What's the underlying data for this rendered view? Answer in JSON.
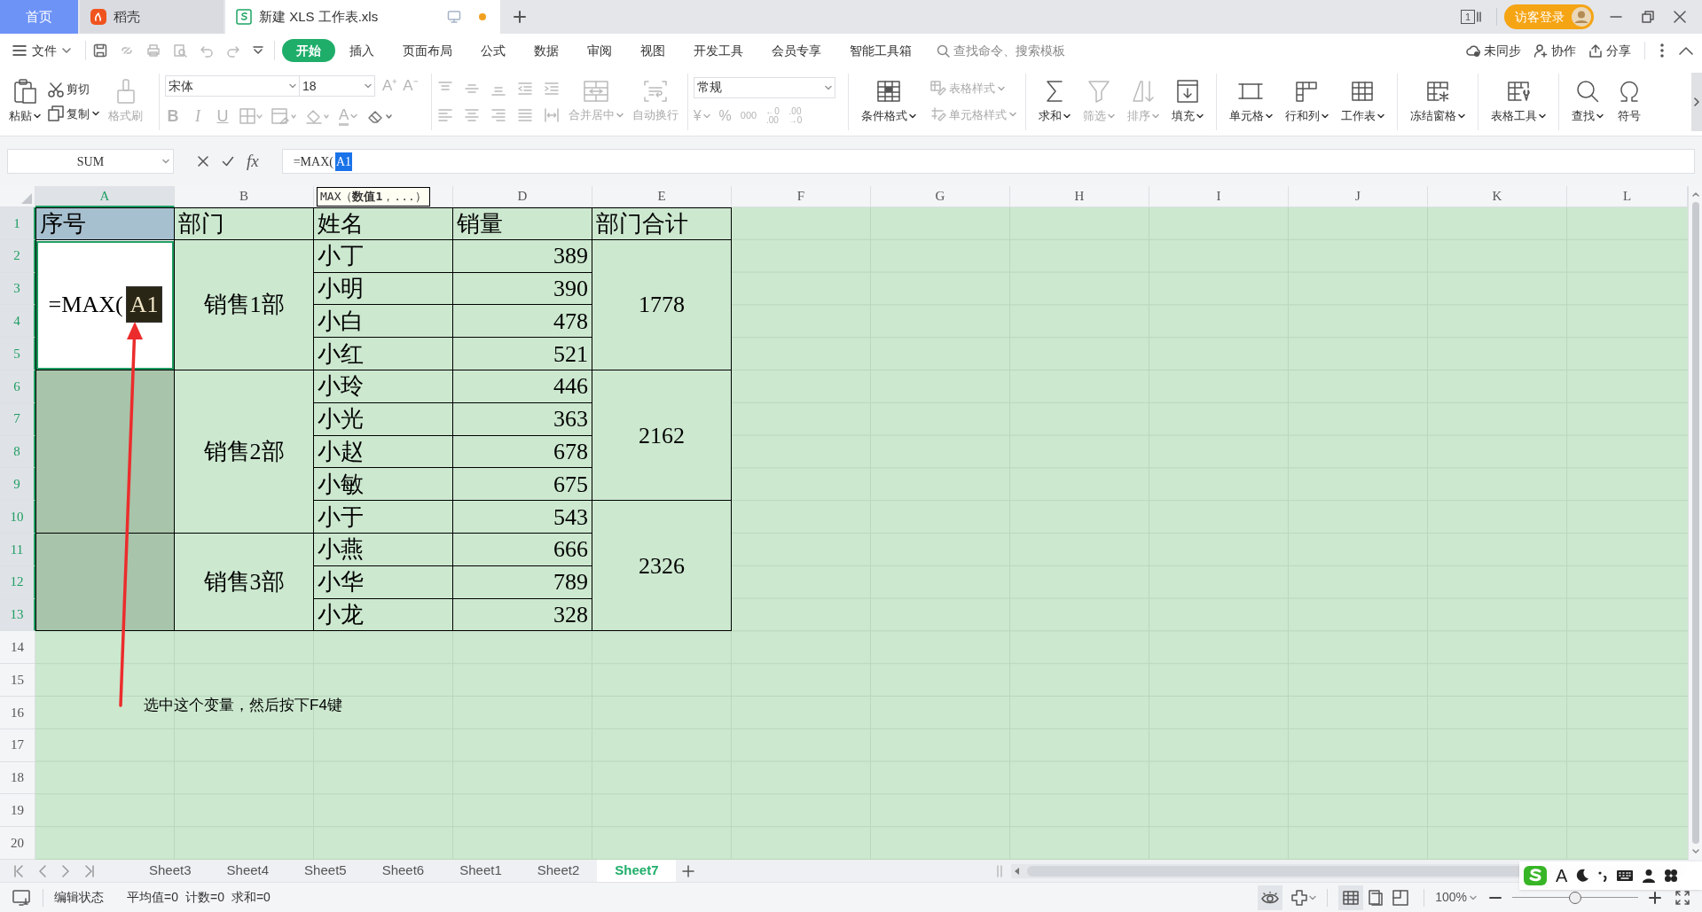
{
  "tabs": [
    {
      "label": "首页",
      "kind": "home",
      "selected": false,
      "unsaved": false
    },
    {
      "label": "稻壳",
      "kind": "store",
      "selected": false,
      "unsaved": false
    },
    {
      "label": "新建 XLS 工作表.xls",
      "kind": "document",
      "selected": true,
      "unsaved": true
    }
  ],
  "window_count": "1",
  "login_button": "访客登录",
  "menu": {
    "file": "文件",
    "tabs": [
      {
        "label": "开始",
        "selected": true
      },
      {
        "label": "插入",
        "selected": false
      },
      {
        "label": "页面布局",
        "selected": false
      },
      {
        "label": "公式",
        "selected": false
      },
      {
        "label": "数据",
        "selected": false
      },
      {
        "label": "审阅",
        "selected": false
      },
      {
        "label": "视图",
        "selected": false
      },
      {
        "label": "开发工具",
        "selected": false
      },
      {
        "label": "会员专享",
        "selected": false
      },
      {
        "label": "智能工具箱",
        "selected": false
      }
    ],
    "search": {
      "placeholder": "查找命令、搜索模板"
    },
    "actions": [
      "未同步",
      "协作",
      "分享"
    ]
  },
  "ribbon": {
    "clipboard": {
      "paste": "粘贴",
      "cut": "剪切",
      "copy": "复制",
      "format_painter": {
        "label": "格式刷",
        "disabled": true
      }
    },
    "font": {
      "disabled": true,
      "name": "宋体",
      "size": "18",
      "grow": "A⁺",
      "shrink": "A⁻",
      "styles": [
        "B",
        "I",
        "U"
      ],
      "color_letter": "A"
    },
    "alignment": {
      "disabled": true,
      "merge": "合并居中",
      "wrap": "自动换行"
    },
    "number": {
      "disabled": true,
      "format": "常规",
      "symbols": [
        "¥",
        "%",
        "000"
      ],
      "decimals": [
        {
          "top": "←0",
          "bottom": ".00"
        },
        {
          "top": ".00",
          "bottom": "→0"
        }
      ]
    },
    "tool_groups": [
      [
        {
          "kind": "big",
          "label": "条件格式",
          "disabled": false,
          "dropdown": true
        },
        {
          "kind": "small",
          "label": "表格样式",
          "disabled": true,
          "dropdown": true
        },
        {
          "kind": "small",
          "label": "单元格样式",
          "disabled": true,
          "dropdown": true
        }
      ],
      [
        {
          "kind": "big",
          "label": "求和",
          "disabled": false,
          "dropdown": true
        },
        {
          "kind": "big",
          "label": "筛选",
          "disabled": true,
          "dropdown": true
        },
        {
          "kind": "big",
          "label": "排序",
          "disabled": true,
          "dropdown": true
        },
        {
          "kind": "big",
          "label": "填充",
          "disabled": false,
          "dropdown": true
        }
      ],
      [
        {
          "kind": "big",
          "label": "单元格",
          "disabled": false,
          "dropdown": true
        },
        {
          "kind": "big",
          "label": "行和列",
          "disabled": false,
          "dropdown": true
        },
        {
          "kind": "big",
          "label": "工作表",
          "disabled": false,
          "dropdown": true
        }
      ],
      [
        {
          "kind": "big",
          "label": "冻结窗格",
          "disabled": false,
          "dropdown": true
        }
      ],
      [
        {
          "kind": "big",
          "label": "表格工具",
          "disabled": false,
          "dropdown": true
        }
      ],
      [
        {
          "kind": "big",
          "label": "查找",
          "disabled": false,
          "dropdown": true
        },
        {
          "kind": "big",
          "label": "符号",
          "disabled": false,
          "dropdown": false
        }
      ]
    ]
  },
  "formula_bar": {
    "name_box": "SUM",
    "fx": "fx",
    "value": "=MAX(",
    "selected_text": "A1"
  },
  "tooltip": "MAX（**数值1**，...）",
  "sheet": {
    "columns": [
      {
        "label": "A",
        "selected": true
      },
      {
        "label": "B",
        "selected": false
      },
      {
        "selected": false
      },
      {
        "label": "D",
        "selected": false
      },
      {
        "label": "E",
        "selected": false
      },
      {
        "label": "F",
        "selected": false
      },
      {
        "label": "G",
        "selected": false
      },
      {
        "label": "H",
        "selected": false
      },
      {
        "label": "I",
        "selected": false
      },
      {
        "label": "J",
        "selected": false
      },
      {
        "label": "K",
        "selected": false
      },
      {
        "label": "L",
        "selected": false
      }
    ],
    "rows": [
      {
        "label": "1",
        "selected": true
      },
      {
        "label": "2",
        "selected": true
      },
      {
        "label": "3",
        "selected": true
      },
      {
        "label": "4",
        "selected": true
      },
      {
        "label": "5",
        "selected": true
      },
      {
        "label": "6",
        "selected": true
      },
      {
        "label": "7",
        "selected": true
      },
      {
        "label": "8",
        "selected": true
      },
      {
        "label": "9",
        "selected": true
      },
      {
        "label": "10",
        "selected": true
      },
      {
        "label": "11",
        "selected": true
      },
      {
        "label": "12",
        "selected": true
      },
      {
        "label": "13",
        "selected": true
      },
      {
        "label": "14",
        "selected": false
      },
      {
        "label": "15",
        "selected": false
      },
      {
        "label": "16",
        "selected": false
      },
      {
        "label": "17",
        "selected": false
      },
      {
        "label": "18",
        "selected": false
      },
      {
        "label": "19",
        "selected": false
      },
      {
        "label": "20",
        "selected": false
      }
    ],
    "table_rows": [
      {
        "cells": [
          {
            "kind": "header",
            "text": "序号",
            "selected": true
          },
          {
            "kind": "header",
            "text": "部门",
            "selected": false
          },
          {
            "kind": "header",
            "text": "姓名",
            "selected": false
          },
          {
            "kind": "header",
            "text": "销量",
            "selected": false
          },
          {
            "kind": "header",
            "text": "部门合计",
            "selected": false
          }
        ]
      },
      {
        "cells": [
          {
            "kind": "editing",
            "text": "=MAX(",
            "selected_text": "A1",
            "selected": true
          },
          {
            "kind": "group",
            "text": "销售1部",
            "selected": false
          },
          {
            "kind": "text",
            "text": "小丁",
            "selected": false
          },
          {
            "kind": "number",
            "text": "389",
            "selected": false
          },
          {
            "kind": "group",
            "text": "1778",
            "selected": false
          }
        ]
      },
      {
        "cells": [
          {
            "kind": "merged"
          },
          {
            "kind": "merged"
          },
          {
            "kind": "text",
            "text": "小明",
            "selected": false
          },
          {
            "kind": "number",
            "text": "390",
            "selected": false
          },
          {
            "kind": "merged"
          }
        ]
      },
      {
        "cells": [
          {
            "kind": "merged"
          },
          {
            "kind": "merged"
          },
          {
            "kind": "text",
            "text": "小白",
            "selected": false
          },
          {
            "kind": "number",
            "text": "478",
            "selected": false
          },
          {
            "kind": "merged"
          }
        ]
      },
      {
        "cells": [
          {
            "kind": "merged"
          },
          {
            "kind": "merged"
          },
          {
            "kind": "text",
            "text": "小红",
            "selected": false
          },
          {
            "kind": "number",
            "text": "521",
            "selected": false
          },
          {
            "kind": "merged"
          }
        ]
      },
      {
        "cells": [
          {
            "kind": "blank",
            "selected": true
          },
          {
            "kind": "group",
            "text": "销售2部",
            "selected": false
          },
          {
            "kind": "text",
            "text": "小玲",
            "selected": false
          },
          {
            "kind": "number",
            "text": "446",
            "selected": false
          },
          {
            "kind": "group",
            "text": "2162",
            "selected": false
          }
        ]
      },
      {
        "cells": [
          {
            "kind": "merged"
          },
          {
            "kind": "merged"
          },
          {
            "kind": "text",
            "text": "小光",
            "selected": false
          },
          {
            "kind": "number",
            "text": "363",
            "selected": false
          },
          {
            "kind": "merged"
          }
        ]
      },
      {
        "cells": [
          {
            "kind": "merged"
          },
          {
            "kind": "merged"
          },
          {
            "kind": "text",
            "text": "小赵",
            "selected": false
          },
          {
            "kind": "number",
            "text": "678",
            "selected": false
          },
          {
            "kind": "merged"
          }
        ]
      },
      {
        "cells": [
          {
            "kind": "merged"
          },
          {
            "kind": "merged"
          },
          {
            "kind": "text",
            "text": "小敏",
            "selected": false
          },
          {
            "kind": "number",
            "text": "675",
            "selected": false
          },
          {
            "kind": "merged"
          }
        ]
      },
      {
        "cells": [
          {
            "kind": "merged"
          },
          {
            "kind": "merged"
          },
          {
            "kind": "text",
            "text": "小于",
            "selected": false
          },
          {
            "kind": "number",
            "text": "543",
            "selected": false
          },
          {
            "kind": "group",
            "text": "2326",
            "selected": false
          }
        ]
      },
      {
        "cells": [
          {
            "kind": "blank",
            "selected": true
          },
          {
            "kind": "group",
            "text": "销售3部",
            "selected": false
          },
          {
            "kind": "text",
            "text": "小燕",
            "selected": false
          },
          {
            "kind": "number",
            "text": "666",
            "selected": false
          },
          {
            "kind": "merged"
          }
        ]
      },
      {
        "cells": [
          {
            "kind": "merged"
          },
          {
            "kind": "merged"
          },
          {
            "kind": "text",
            "text": "小华",
            "selected": false
          },
          {
            "kind": "number",
            "text": "789",
            "selected": false
          },
          {
            "kind": "merged"
          }
        ]
      },
      {
        "cells": [
          {
            "kind": "merged"
          },
          {
            "kind": "merged"
          },
          {
            "kind": "text",
            "text": "小龙",
            "selected": false
          },
          {
            "kind": "number",
            "text": "328",
            "selected": false
          },
          {
            "kind": "merged"
          }
        ]
      }
    ]
  },
  "annotation": "选中这个变量，然后按下F4键",
  "sheet_tabs": [
    {
      "label": "Sheet3",
      "selected": false
    },
    {
      "label": "Sheet4",
      "selected": false
    },
    {
      "label": "Sheet5",
      "selected": false
    },
    {
      "label": "Sheet6",
      "selected": false
    },
    {
      "label": "Sheet1",
      "selected": false
    },
    {
      "label": "Sheet2",
      "selected": false
    },
    {
      "label": "Sheet7",
      "selected": true
    }
  ],
  "status_bar": {
    "mode": "编辑状态",
    "stats": [
      "平均值=0",
      "计数=0",
      "求和=0"
    ],
    "zoom": "100%",
    "zoom_slider": {
      "level": 0.5
    }
  },
  "ime_toolbar": {
    "mode": "A"
  }
}
